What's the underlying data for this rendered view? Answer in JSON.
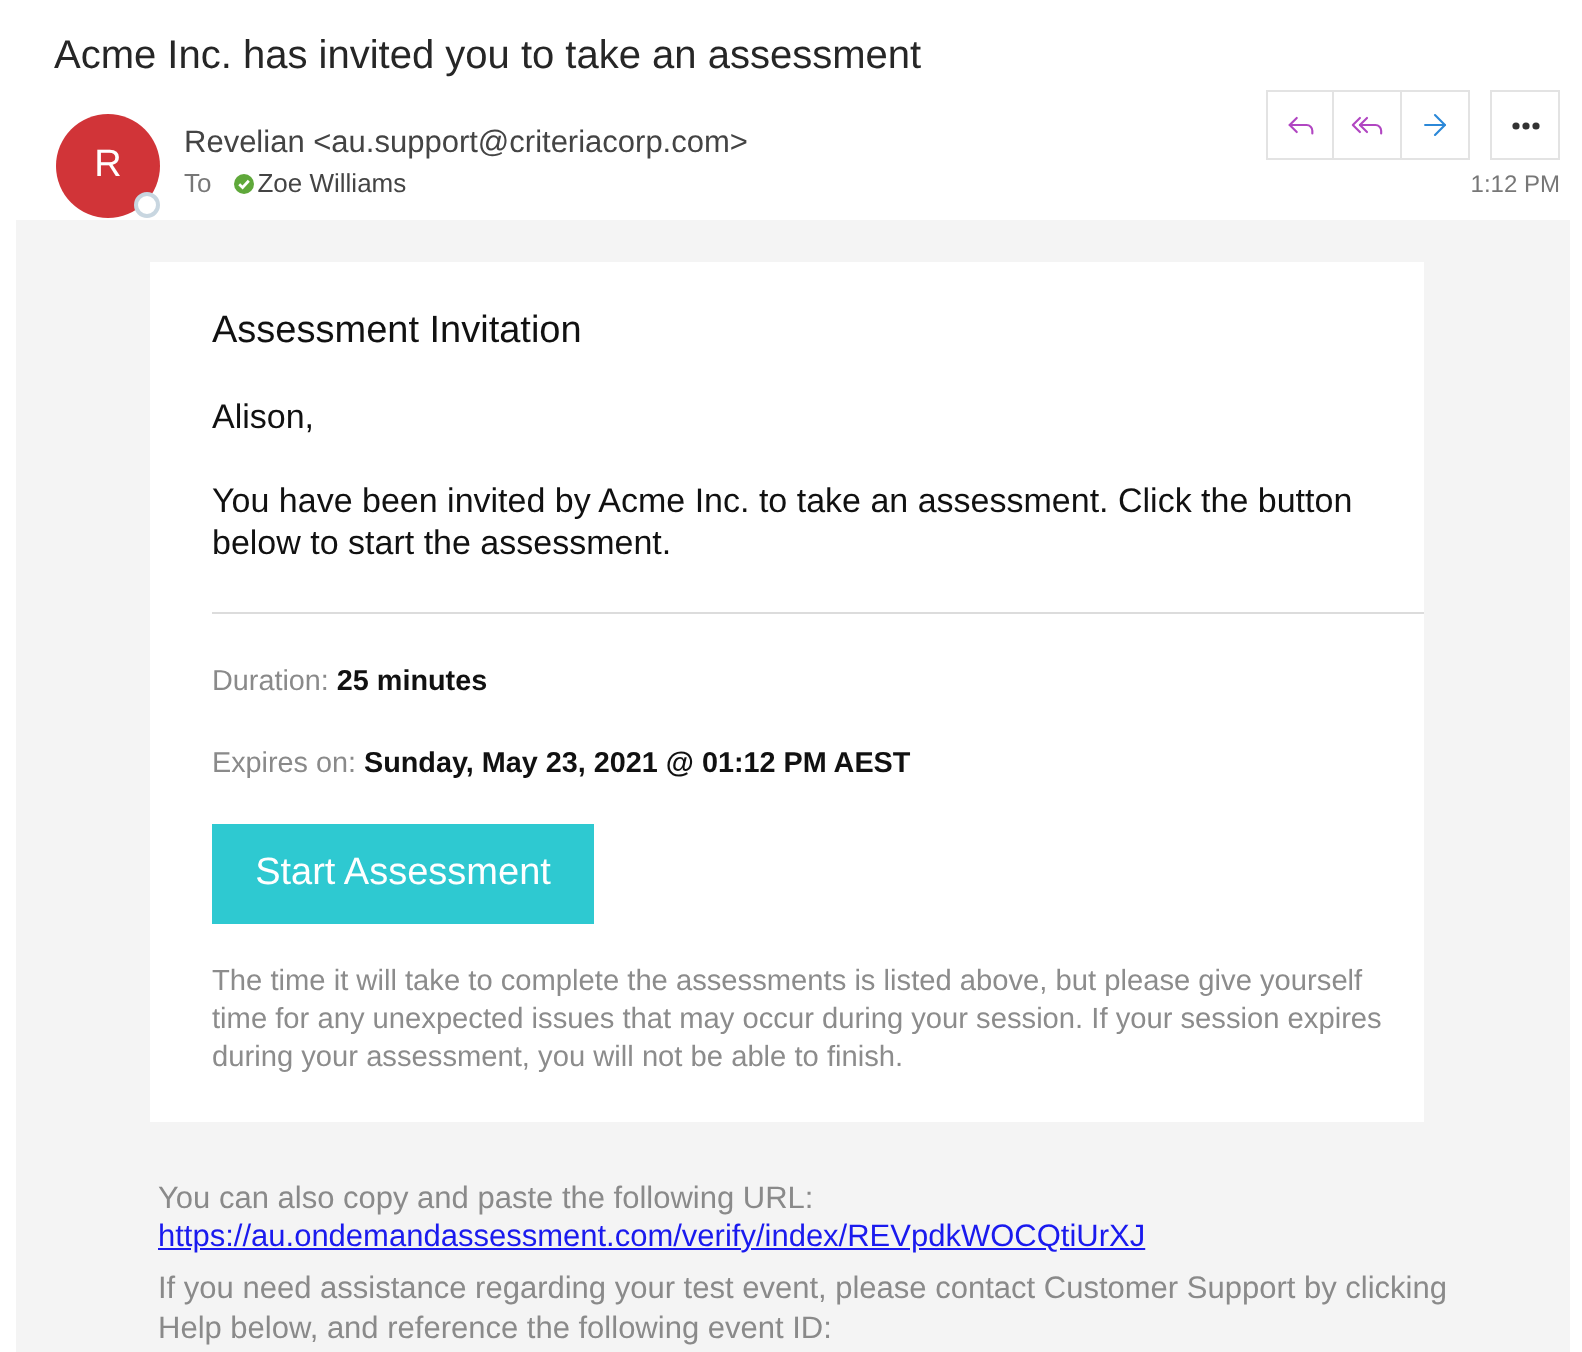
{
  "subject": "Acme Inc. has invited you to take an assessment",
  "header": {
    "avatar_initial": "R",
    "sender": "Revelian <au.support@criteriacorp.com>",
    "to_label": "To",
    "recipients": [
      {
        "name": "Zoe Williams"
      }
    ],
    "time": "1:12 PM"
  },
  "card": {
    "heading": "Assessment Invitation",
    "greeting": "Alison,",
    "intro": "You have been invited by Acme Inc. to take an assessment. Click the button below to start the assessment.",
    "details": [
      {
        "label": "Duration:",
        "value": "25 minutes"
      },
      {
        "label": "Expires on:",
        "value": "Sunday, May 23, 2021 @ 01:12 PM AEST"
      }
    ],
    "button": "Start Assessment",
    "note": "The time it will take to complete the assessments is listed above, but please give yourself time for any unexpected issues that may occur during your session. If your session expires during your assessment, you will not be able to finish."
  },
  "footer": [
    {
      "kind": "text",
      "text": "You can also copy and paste the following URL:"
    },
    {
      "kind": "link",
      "text": "https://au.ondemandassessment.com/verify/index/REVpdkWOCQtiUrXJ"
    },
    {
      "kind": "text",
      "text": "If you need assistance regarding your test event, please contact Customer Support by clicking Help below, and reference the following event ID:"
    }
  ]
}
